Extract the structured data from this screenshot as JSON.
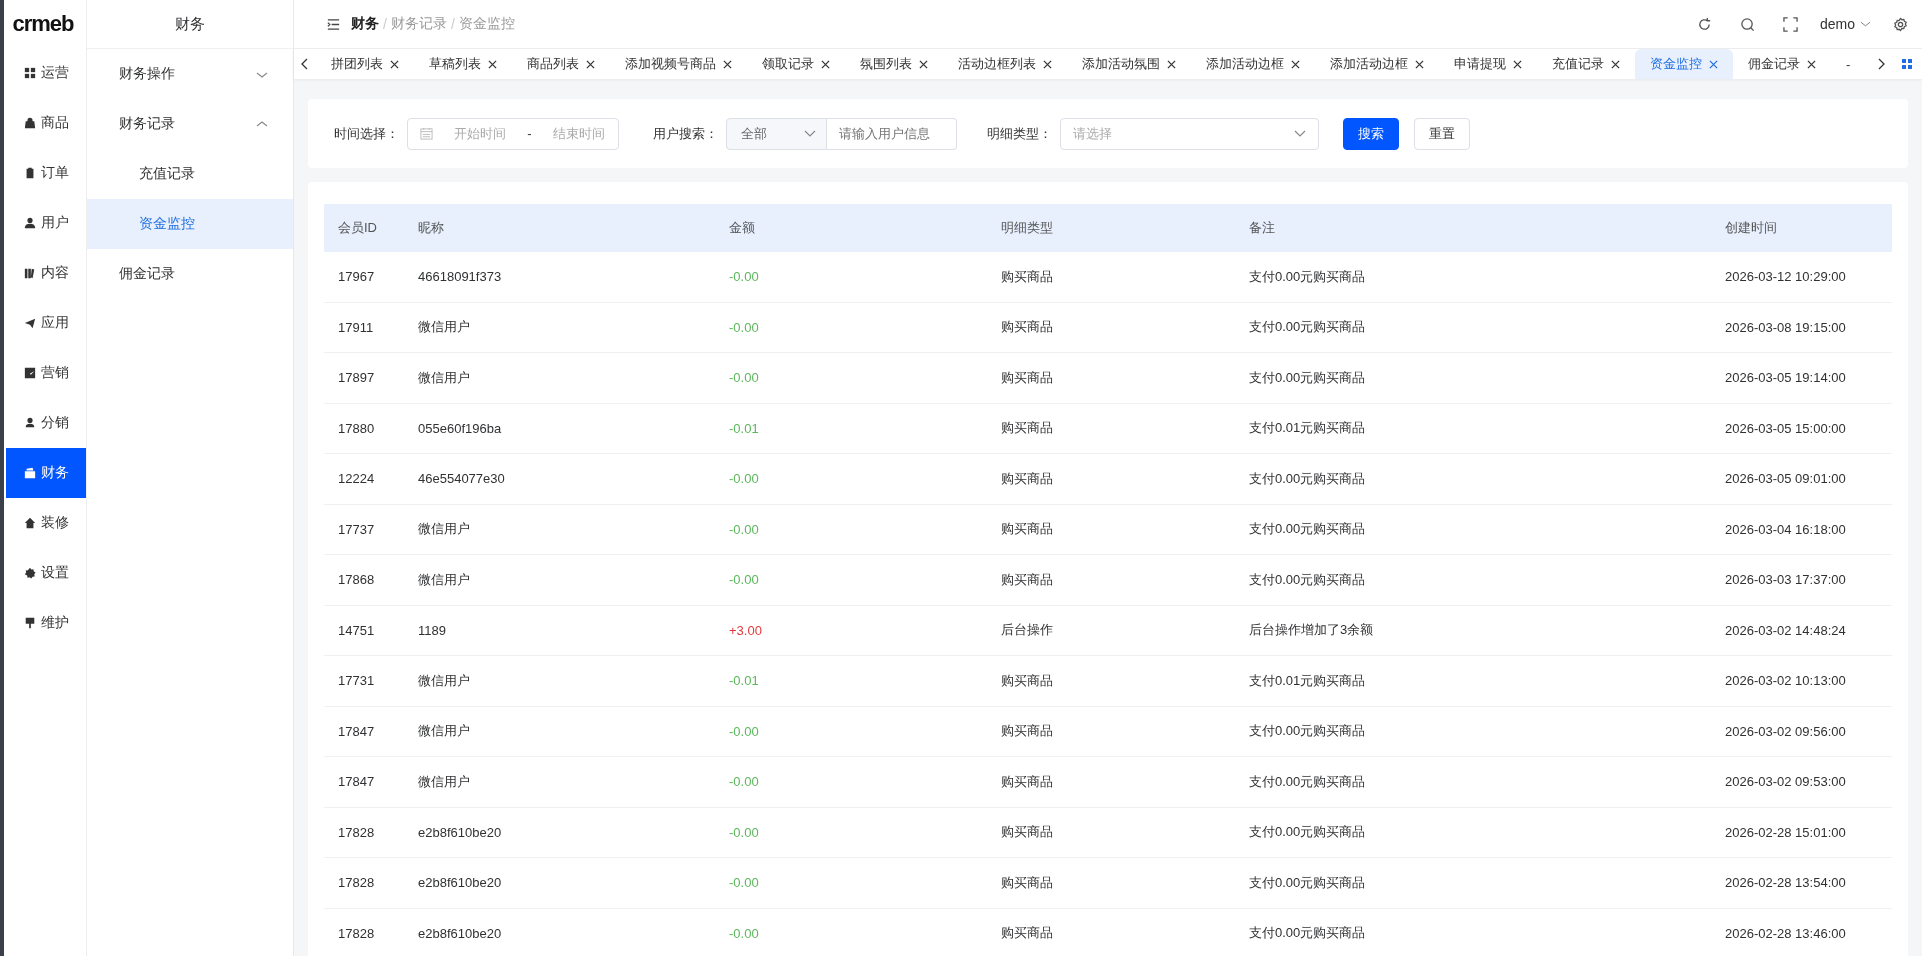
{
  "logo": "crmeb",
  "rail": [
    {
      "label": "运营",
      "selected": false
    },
    {
      "label": "商品",
      "selected": false
    },
    {
      "label": "订单",
      "selected": false
    },
    {
      "label": "用户",
      "selected": false
    },
    {
      "label": "内容",
      "selected": false
    },
    {
      "label": "应用",
      "selected": false
    },
    {
      "label": "营销",
      "selected": false
    },
    {
      "label": "分销",
      "selected": false
    },
    {
      "label": "财务",
      "selected": true
    },
    {
      "label": "装修",
      "selected": false
    },
    {
      "label": "设置",
      "selected": false
    },
    {
      "label": "维护",
      "selected": false
    }
  ],
  "subnav": {
    "title": "财务",
    "items": [
      {
        "kind": "group",
        "label": "财务操作",
        "expanded": false,
        "selected": false
      },
      {
        "kind": "group",
        "label": "财务记录",
        "expanded": true,
        "selected": false,
        "children": [
          {
            "label": "充值记录",
            "selected": false
          },
          {
            "label": "资金监控",
            "selected": true
          }
        ]
      },
      {
        "kind": "link",
        "label": "佣金记录",
        "selected": false
      }
    ]
  },
  "breadcrumb": {
    "items": [
      "财务",
      "财务记录",
      "资金监控"
    ],
    "separators": [
      "/",
      "/"
    ]
  },
  "user": "demo",
  "tabs": [
    {
      "label": "拼团列表",
      "selected": false,
      "closable": true
    },
    {
      "label": "草稿列表",
      "selected": false,
      "closable": true
    },
    {
      "label": "商品列表",
      "selected": false,
      "closable": true
    },
    {
      "label": "添加视频号商品",
      "selected": false,
      "closable": true
    },
    {
      "label": "领取记录",
      "selected": false,
      "closable": true
    },
    {
      "label": "氛围列表",
      "selected": false,
      "closable": true
    },
    {
      "label": "活动边框列表",
      "selected": false,
      "closable": true
    },
    {
      "label": "添加活动氛围",
      "selected": false,
      "closable": true
    },
    {
      "label": "添加活动边框",
      "selected": false,
      "closable": true
    },
    {
      "label": "添加活动边框",
      "selected": false,
      "closable": true
    },
    {
      "label": "申请提现",
      "selected": false,
      "closable": true
    },
    {
      "label": "充值记录",
      "selected": false,
      "closable": true
    },
    {
      "label": "资金监控",
      "selected": true,
      "closable": true
    },
    {
      "label": "佣金记录",
      "selected": false,
      "closable": true
    },
    {
      "label": "-",
      "selected": false,
      "closable": false
    }
  ],
  "filters": {
    "time": {
      "label": "时间选择：",
      "start_placeholder": "开始时间",
      "separator": "-",
      "end_placeholder": "结束时间"
    },
    "user": {
      "label": "用户搜索：",
      "scope": "全部",
      "placeholder": "请输入用户信息"
    },
    "type": {
      "label": "明细类型：",
      "placeholder": "请选择"
    },
    "buttons": [
      "搜索",
      "重置"
    ]
  },
  "table": {
    "columns": [
      "会员ID",
      "昵称",
      "金额",
      "明细类型",
      "备注",
      "创建时间"
    ],
    "rows": [
      {
        "id": "17967",
        "nickname": "46618091f373",
        "amount": "-0.00",
        "color": "#5cb85c",
        "type": "购买商品",
        "note": "支付0.00元购买商品",
        "time": "2026-03-12 10:29:00"
      },
      {
        "id": "17911",
        "nickname": "微信用户",
        "amount": "-0.00",
        "color": "#5cb85c",
        "type": "购买商品",
        "note": "支付0.00元购买商品",
        "time": "2026-03-08 19:15:00"
      },
      {
        "id": "17897",
        "nickname": "微信用户",
        "amount": "-0.00",
        "color": "#5cb85c",
        "type": "购买商品",
        "note": "支付0.00元购买商品",
        "time": "2026-03-05 19:14:00"
      },
      {
        "id": "17880",
        "nickname": "055e60f196ba",
        "amount": "-0.01",
        "color": "#5cb85c",
        "type": "购买商品",
        "note": "支付0.01元购买商品",
        "time": "2026-03-05 15:00:00"
      },
      {
        "id": "12224",
        "nickname": "46e554077e30",
        "amount": "-0.00",
        "color": "#5cb85c",
        "type": "购买商品",
        "note": "支付0.00元购买商品",
        "time": "2026-03-05 09:01:00"
      },
      {
        "id": "17737",
        "nickname": "微信用户",
        "amount": "-0.00",
        "color": "#5cb85c",
        "type": "购买商品",
        "note": "支付0.00元购买商品",
        "time": "2026-03-04 16:18:00"
      },
      {
        "id": "17868",
        "nickname": "微信用户",
        "amount": "-0.00",
        "color": "#5cb85c",
        "type": "购买商品",
        "note": "支付0.00元购买商品",
        "time": "2026-03-03 17:37:00"
      },
      {
        "id": "14751",
        "nickname": "1189",
        "amount": "+3.00",
        "color": "#e4393c",
        "type": "后台操作",
        "note": "后台操作增加了3余额",
        "time": "2026-03-02 14:48:24"
      },
      {
        "id": "17731",
        "nickname": "微信用户",
        "amount": "-0.01",
        "color": "#5cb85c",
        "type": "购买商品",
        "note": "支付0.01元购买商品",
        "time": "2026-03-02 10:13:00"
      },
      {
        "id": "17847",
        "nickname": "微信用户",
        "amount": "-0.00",
        "color": "#5cb85c",
        "type": "购买商品",
        "note": "支付0.00元购买商品",
        "time": "2026-03-02 09:56:00"
      },
      {
        "id": "17847",
        "nickname": "微信用户",
        "amount": "-0.00",
        "color": "#5cb85c",
        "type": "购买商品",
        "note": "支付0.00元购买商品",
        "time": "2026-03-02 09:53:00"
      },
      {
        "id": "17828",
        "nickname": "e2b8f610be20",
        "amount": "-0.00",
        "color": "#5cb85c",
        "type": "购买商品",
        "note": "支付0.00元购买商品",
        "time": "2026-02-28 15:01:00"
      },
      {
        "id": "17828",
        "nickname": "e2b8f610be20",
        "amount": "-0.00",
        "color": "#5cb85c",
        "type": "购买商品",
        "note": "支付0.00元购买商品",
        "time": "2026-02-28 13:54:00"
      },
      {
        "id": "17828",
        "nickname": "e2b8f610be20",
        "amount": "-0.00",
        "color": "#5cb85c",
        "type": "购买商品",
        "note": "支付0.00元购买商品",
        "time": "2026-02-28 13:46:00"
      }
    ]
  }
}
